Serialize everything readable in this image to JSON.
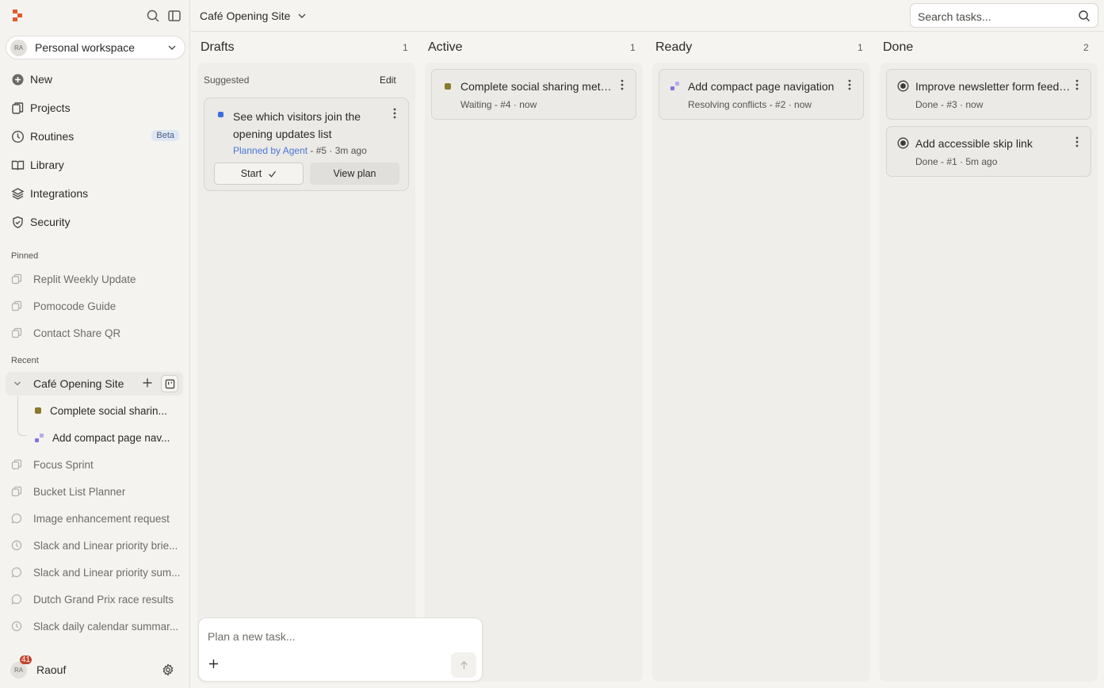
{
  "sidebar": {
    "workspace": {
      "avatar": "RA",
      "label": "Personal workspace"
    },
    "nav": [
      {
        "label": "New",
        "icon": "plus-circle-icon"
      },
      {
        "label": "Projects",
        "icon": "projects-icon"
      },
      {
        "label": "Routines",
        "icon": "clock-icon",
        "badge": "Beta"
      },
      {
        "label": "Library",
        "icon": "book-icon"
      },
      {
        "label": "Integrations",
        "icon": "layers-icon"
      },
      {
        "label": "Security",
        "icon": "shield-icon"
      }
    ],
    "pinned_label": "Pinned",
    "pinned": [
      "Replit Weekly Update",
      "Pomocode Guide",
      "Contact Share QR"
    ],
    "recent_label": "Recent",
    "recent_active": "Café Opening Site",
    "recent_children": [
      "Complete social sharin...",
      "Add compact page nav..."
    ],
    "recent": [
      {
        "label": "Focus Sprint",
        "icon": "copy-icon"
      },
      {
        "label": "Bucket List Planner",
        "icon": "copy-icon"
      },
      {
        "label": "Image enhancement request",
        "icon": "chat-icon"
      },
      {
        "label": "Slack and Linear priority brie...",
        "icon": "clock-icon"
      },
      {
        "label": "Slack and Linear priority sum...",
        "icon": "chat-icon"
      },
      {
        "label": "Dutch Grand Prix race results",
        "icon": "chat-icon"
      },
      {
        "label": "Slack daily calendar summar...",
        "icon": "clock-icon"
      }
    ],
    "user": {
      "avatar": "RA",
      "count": "41",
      "name": "Raouf"
    }
  },
  "header": {
    "title": "Café Opening Site",
    "search_placeholder": "Search tasks..."
  },
  "columns": [
    {
      "title": "Drafts",
      "count": "1"
    },
    {
      "title": "Active",
      "count": "1"
    },
    {
      "title": "Ready",
      "count": "1"
    },
    {
      "title": "Done",
      "count": "2"
    }
  ],
  "drafts": {
    "suggested": "Suggested",
    "edit": "Edit",
    "card": {
      "title": "See which visitors join the opening updates list",
      "planned_by": "Planned by Agent",
      "meta": " - #5 · 3m ago",
      "start": "Start",
      "view_plan": "View plan"
    }
  },
  "active": [
    {
      "title": "Complete social sharing metadata",
      "meta": "Waiting - #4 · now"
    }
  ],
  "ready": [
    {
      "title": "Add compact page navigation",
      "meta": "Resolving conflicts - #2 · now"
    }
  ],
  "done": [
    {
      "title": "Improve newsletter form feedback",
      "meta": "Done - #3 · now"
    },
    {
      "title": "Add accessible skip link",
      "meta": "Done - #1 · 5m ago"
    }
  ],
  "composer": {
    "placeholder": "Plan a new task..."
  },
  "colors": {
    "accent_blue": "#3d6de0",
    "status_olive": "#8a7a2e",
    "status_purple": "#8b6ee8",
    "logo_orange": "#e05a2e"
  }
}
